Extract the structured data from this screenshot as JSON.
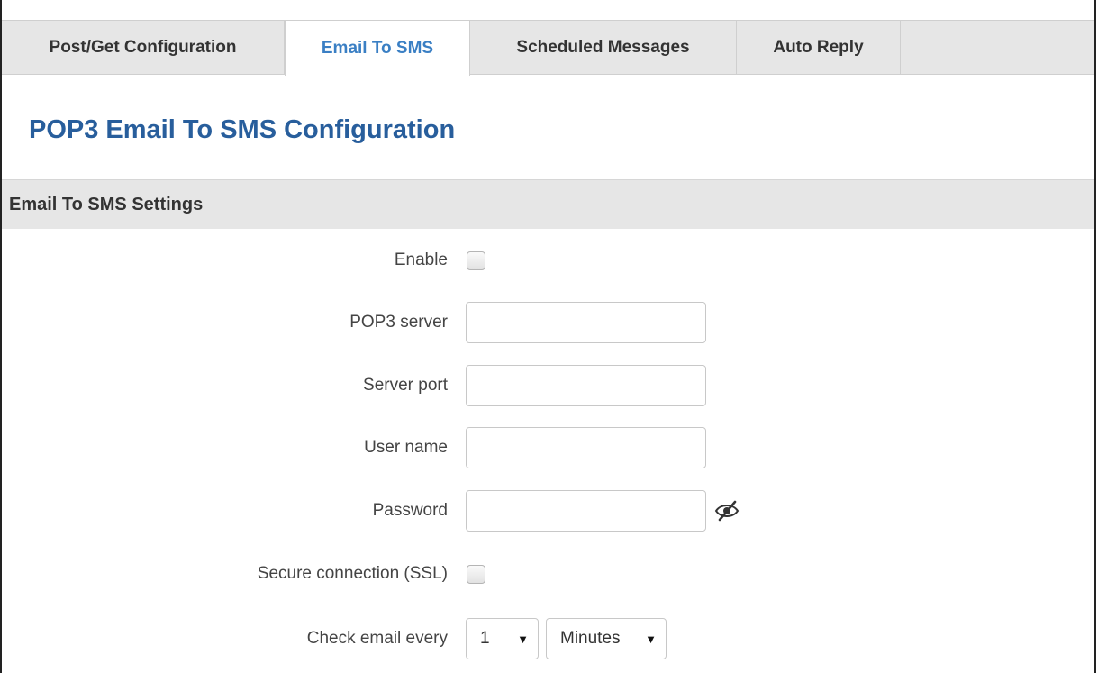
{
  "tabs": [
    {
      "label": "Post/Get Configuration",
      "active": false
    },
    {
      "label": "Email To SMS",
      "active": true
    },
    {
      "label": "Scheduled Messages",
      "active": false
    },
    {
      "label": "Auto Reply",
      "active": false
    }
  ],
  "page_title": "POP3 Email To SMS Configuration",
  "section_title": "Email To SMS Settings",
  "form": {
    "enable_label": "Enable",
    "enable_checked": false,
    "pop3_server_label": "POP3 server",
    "pop3_server_value": "",
    "server_port_label": "Server port",
    "server_port_value": "",
    "user_name_label": "User name",
    "user_name_value": "",
    "password_label": "Password",
    "password_value": "",
    "ssl_label": "Secure connection (SSL)",
    "ssl_checked": false,
    "check_every_label": "Check email every",
    "check_every_value": "1",
    "check_every_unit": "Minutes"
  },
  "icons": {
    "password_toggle": "eye-slash-icon",
    "dropdown_arrow": "▼"
  },
  "colors": {
    "accent": "#3a7fc4",
    "title": "#285e9c",
    "bar_bg": "#e6e6e6"
  }
}
